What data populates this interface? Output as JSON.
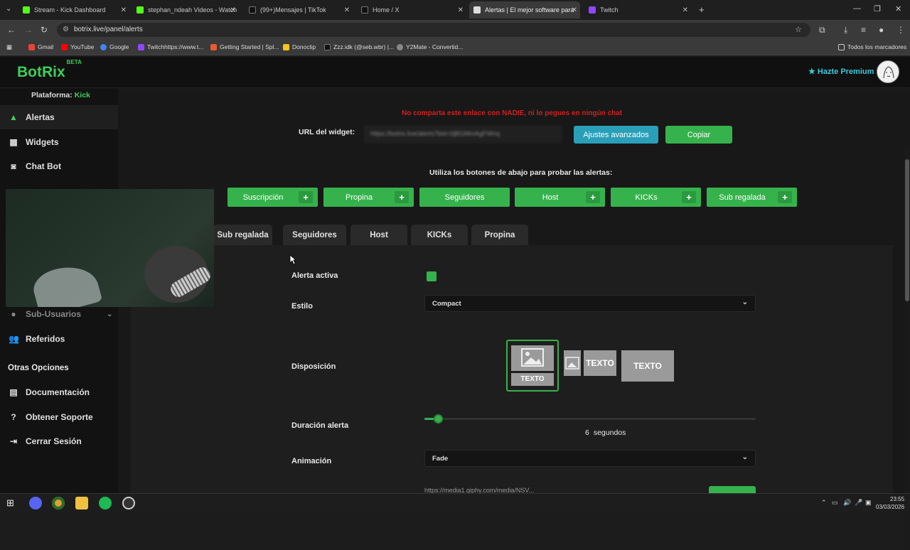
{
  "browser": {
    "tabs": [
      {
        "label": "Stream - Kick Dashboard",
        "color": "#53fc18"
      },
      {
        "label": "stephan_ndeah Videos - Watch",
        "color": "#53fc18"
      },
      {
        "label": "(99+)Mensajes | TikTok",
        "color": "#111111"
      },
      {
        "label": "Home / X",
        "color": "#111111"
      },
      {
        "label": "Alertas | El mejor software para",
        "color": "#dddddd"
      },
      {
        "label": "Twitch",
        "color": "#9146ff"
      }
    ],
    "active_tab": 4,
    "url": "botrix.live/panel/alerts",
    "bookmarks": [
      {
        "label": "Gmail",
        "color": "#ea4335"
      },
      {
        "label": "YouTube",
        "color": "#ff0000"
      },
      {
        "label": "Google",
        "color": "#4285f4"
      },
      {
        "label": "Twitchhttps://www.t...",
        "color": "#9146ff"
      },
      {
        "label": "Getting Started | Spl...",
        "color": "#e85a2a"
      },
      {
        "label": "Donoclip",
        "color": "#f5c518"
      },
      {
        "label": "Zzz.idk (@seb.wbr) |...",
        "color": "#111111"
      },
      {
        "label": "Y2Mate - Convertid...",
        "color": "#888888"
      }
    ],
    "all_bookmarks": "Todos los marcadores"
  },
  "app": {
    "logo": "BotRix",
    "logo_badge": "BETA",
    "premium": "Hazte Premium",
    "platform_label": "Plataforma:",
    "platform_value": "Kick",
    "sidebar": {
      "items": [
        {
          "label": "Alertas",
          "icon": "warning-icon"
        },
        {
          "label": "Widgets",
          "icon": "grid-icon"
        },
        {
          "label": "Chat Bot",
          "icon": "robot-icon"
        },
        {
          "label": "Sub-Usuarios",
          "icon": "users-icon"
        },
        {
          "label": "Referidos",
          "icon": "users-icon"
        }
      ],
      "section": "Otras Opciones",
      "other_items": [
        {
          "label": "Documentación",
          "icon": "document-icon"
        },
        {
          "label": "Obtener Soporte",
          "icon": "help-icon"
        },
        {
          "label": "Cerrar Sesión",
          "icon": "logout-icon"
        }
      ]
    },
    "warning": "No comparta este enlace con NADIE, ni lo pegues en ningún chat",
    "widget_label": "URL del widget:",
    "widget_url": "https://botrix.live/alerts?bid=0jBGMmAgFWnq",
    "advanced_button": "Ajustes avanzados",
    "copy_button": "Copiar",
    "test_hint": "Utiliza los botones de abajo para probar las alertas:",
    "test_buttons": [
      {
        "label": "Suscripción",
        "plus": true
      },
      {
        "label": "Propina",
        "plus": true
      },
      {
        "label": "Seguidores",
        "plus": false
      },
      {
        "label": "Host",
        "plus": true
      },
      {
        "label": "KICKs",
        "plus": true
      },
      {
        "label": "Sub regalada",
        "plus": true
      }
    ],
    "tabs": [
      "Sub regalada",
      "Seguidores",
      "Host",
      "KICKs",
      "Propina"
    ],
    "form": {
      "active_label": "Alerta activa",
      "style_label": "Estilo",
      "style_value": "Compact",
      "layout_label": "Disposición",
      "layout_text": "TEXTO",
      "duration_label": "Duración alerta",
      "duration_value": "6",
      "duration_unit": "segundos",
      "duration_fraction": 0.04,
      "animation_label": "Animación",
      "animation_value": "Fade",
      "sound_value": "https://media1.giphy.com/media/NSV..."
    }
  },
  "taskbar": {
    "time": "23:55",
    "date": "03/03/2026"
  },
  "colors": {
    "accent": "#36b24c",
    "logo": "#3ecf5a",
    "warning": "#d02020",
    "info_button": "#2a9fb8"
  }
}
